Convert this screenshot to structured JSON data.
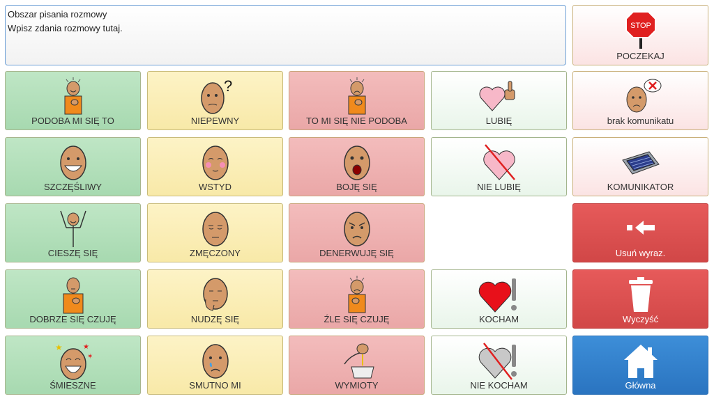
{
  "message_area": {
    "title": "Obszar pisania rozmowy",
    "hint": "Wpisz zdania rozmowy tutaj."
  },
  "tiles": {
    "podoba": "PODOBA MI SIĘ TO",
    "niepewny": "NIEPEWNY",
    "nie_podoba": "TO MI SIĘ NIE PODOBA",
    "lubie": "LUBIĘ",
    "brak": "brak komunikatu",
    "poczekaj": "POCZEKAJ",
    "szczesliwy": "SZCZĘŚLIWY",
    "wstyd": "WSTYD",
    "boje": "BOJĘ SIĘ",
    "nie_lubie": "NIE LUBIĘ",
    "komunikator": "KOMUNIKATOR",
    "ciesze": "CIESZĘ SIĘ",
    "zmeczony": "ZMĘCZONY",
    "denerwuje": "DENERWUJĘ SIĘ",
    "usun": "Usuń wyraz.",
    "dobrze": "DOBRZE SIĘ CZUJĘ",
    "nudze": "NUDZĘ SIĘ",
    "zle": "ŹLE SIĘ CZUJĘ",
    "kocham": "KOCHAM",
    "wyczysc": "Wyczyść",
    "smieszne": "ŚMIESZNE",
    "smutno": "SMUTNO MI",
    "wymioty": "WYMIOTY",
    "nie_kocham": "NIE KOCHAM",
    "glowna": "Główna"
  },
  "stop_sign_text": "STOP",
  "colors": {
    "accent_red": "#d14747",
    "accent_blue": "#2a74c0",
    "skin": "#d49a6a",
    "shirt": "#f08a1c"
  }
}
